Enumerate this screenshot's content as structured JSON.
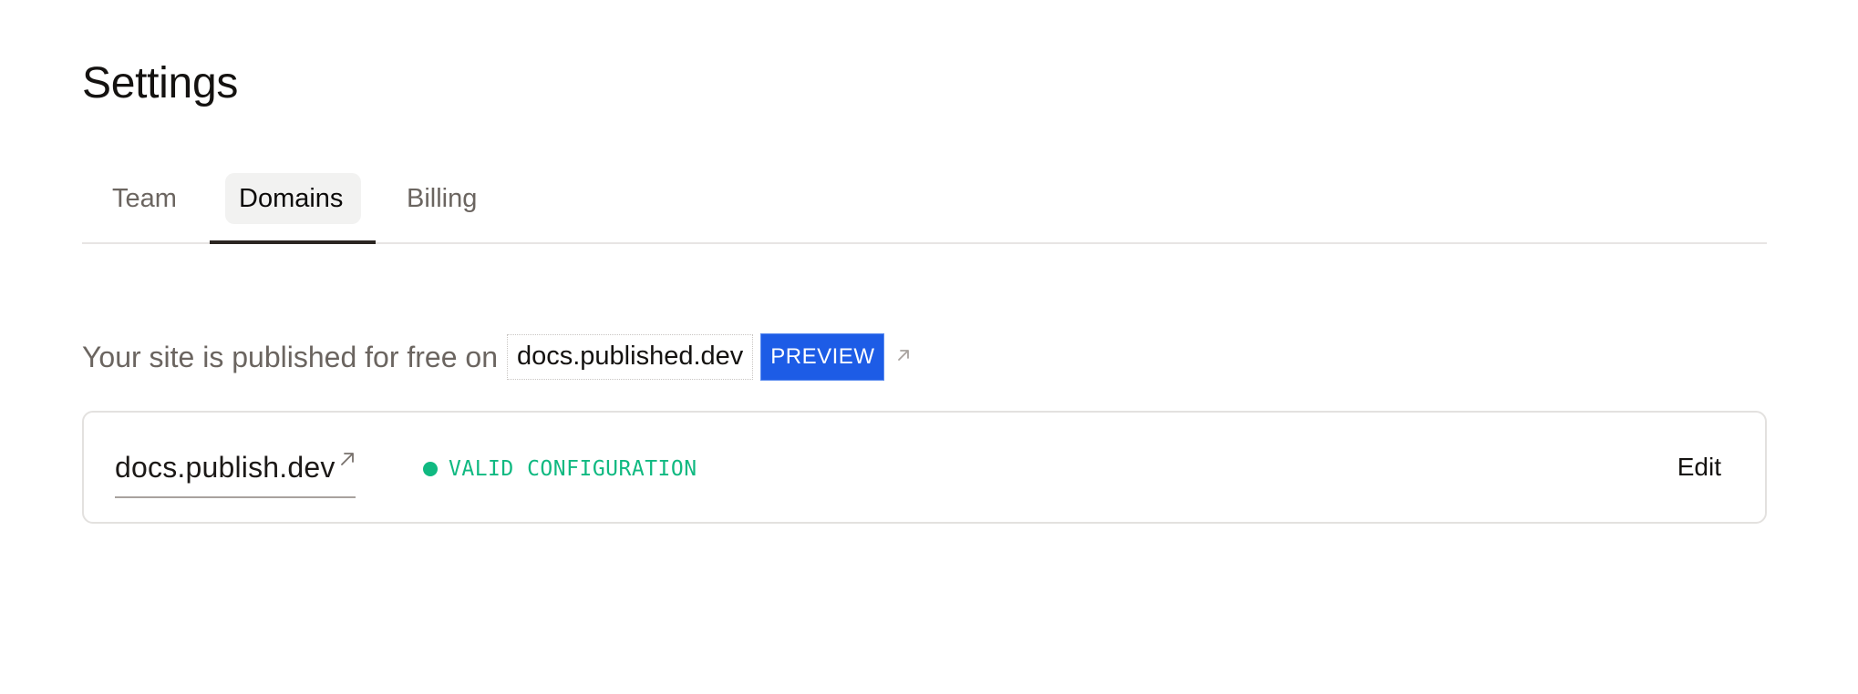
{
  "page": {
    "title": "Settings"
  },
  "tabs": [
    {
      "label": "Team",
      "active": false
    },
    {
      "label": "Domains",
      "active": true
    },
    {
      "label": "Billing",
      "active": false
    }
  ],
  "notice": {
    "text": "Your site is published for free on",
    "free_domain": "docs.published.dev",
    "badge": "PREVIEW",
    "link_icon": "external-link-icon"
  },
  "domains": [
    {
      "name": "docs.publish.dev",
      "link_icon": "external-link-icon",
      "status": "VALID CONFIGURATION",
      "status_color": "#10b981",
      "edit_label": "Edit"
    }
  ],
  "colors": {
    "accent": "#1d5ce6",
    "success": "#10b981",
    "text_muted": "#6b6560",
    "text_primary": "#141210",
    "tab_underline": "#2b2521"
  }
}
